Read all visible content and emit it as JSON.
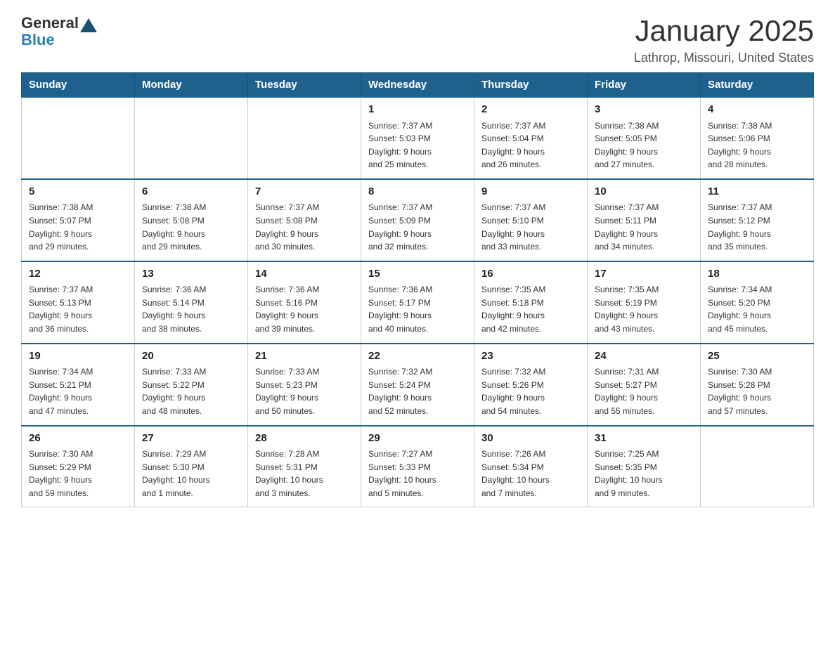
{
  "logo": {
    "general": "General",
    "blue": "Blue"
  },
  "title": "January 2025",
  "subtitle": "Lathrop, Missouri, United States",
  "days_of_week": [
    "Sunday",
    "Monday",
    "Tuesday",
    "Wednesday",
    "Thursday",
    "Friday",
    "Saturday"
  ],
  "weeks": [
    [
      {
        "day": "",
        "info": ""
      },
      {
        "day": "",
        "info": ""
      },
      {
        "day": "",
        "info": ""
      },
      {
        "day": "1",
        "info": "Sunrise: 7:37 AM\nSunset: 5:03 PM\nDaylight: 9 hours\nand 25 minutes."
      },
      {
        "day": "2",
        "info": "Sunrise: 7:37 AM\nSunset: 5:04 PM\nDaylight: 9 hours\nand 26 minutes."
      },
      {
        "day": "3",
        "info": "Sunrise: 7:38 AM\nSunset: 5:05 PM\nDaylight: 9 hours\nand 27 minutes."
      },
      {
        "day": "4",
        "info": "Sunrise: 7:38 AM\nSunset: 5:06 PM\nDaylight: 9 hours\nand 28 minutes."
      }
    ],
    [
      {
        "day": "5",
        "info": "Sunrise: 7:38 AM\nSunset: 5:07 PM\nDaylight: 9 hours\nand 29 minutes."
      },
      {
        "day": "6",
        "info": "Sunrise: 7:38 AM\nSunset: 5:08 PM\nDaylight: 9 hours\nand 29 minutes."
      },
      {
        "day": "7",
        "info": "Sunrise: 7:37 AM\nSunset: 5:08 PM\nDaylight: 9 hours\nand 30 minutes."
      },
      {
        "day": "8",
        "info": "Sunrise: 7:37 AM\nSunset: 5:09 PM\nDaylight: 9 hours\nand 32 minutes."
      },
      {
        "day": "9",
        "info": "Sunrise: 7:37 AM\nSunset: 5:10 PM\nDaylight: 9 hours\nand 33 minutes."
      },
      {
        "day": "10",
        "info": "Sunrise: 7:37 AM\nSunset: 5:11 PM\nDaylight: 9 hours\nand 34 minutes."
      },
      {
        "day": "11",
        "info": "Sunrise: 7:37 AM\nSunset: 5:12 PM\nDaylight: 9 hours\nand 35 minutes."
      }
    ],
    [
      {
        "day": "12",
        "info": "Sunrise: 7:37 AM\nSunset: 5:13 PM\nDaylight: 9 hours\nand 36 minutes."
      },
      {
        "day": "13",
        "info": "Sunrise: 7:36 AM\nSunset: 5:14 PM\nDaylight: 9 hours\nand 38 minutes."
      },
      {
        "day": "14",
        "info": "Sunrise: 7:36 AM\nSunset: 5:16 PM\nDaylight: 9 hours\nand 39 minutes."
      },
      {
        "day": "15",
        "info": "Sunrise: 7:36 AM\nSunset: 5:17 PM\nDaylight: 9 hours\nand 40 minutes."
      },
      {
        "day": "16",
        "info": "Sunrise: 7:35 AM\nSunset: 5:18 PM\nDaylight: 9 hours\nand 42 minutes."
      },
      {
        "day": "17",
        "info": "Sunrise: 7:35 AM\nSunset: 5:19 PM\nDaylight: 9 hours\nand 43 minutes."
      },
      {
        "day": "18",
        "info": "Sunrise: 7:34 AM\nSunset: 5:20 PM\nDaylight: 9 hours\nand 45 minutes."
      }
    ],
    [
      {
        "day": "19",
        "info": "Sunrise: 7:34 AM\nSunset: 5:21 PM\nDaylight: 9 hours\nand 47 minutes."
      },
      {
        "day": "20",
        "info": "Sunrise: 7:33 AM\nSunset: 5:22 PM\nDaylight: 9 hours\nand 48 minutes."
      },
      {
        "day": "21",
        "info": "Sunrise: 7:33 AM\nSunset: 5:23 PM\nDaylight: 9 hours\nand 50 minutes."
      },
      {
        "day": "22",
        "info": "Sunrise: 7:32 AM\nSunset: 5:24 PM\nDaylight: 9 hours\nand 52 minutes."
      },
      {
        "day": "23",
        "info": "Sunrise: 7:32 AM\nSunset: 5:26 PM\nDaylight: 9 hours\nand 54 minutes."
      },
      {
        "day": "24",
        "info": "Sunrise: 7:31 AM\nSunset: 5:27 PM\nDaylight: 9 hours\nand 55 minutes."
      },
      {
        "day": "25",
        "info": "Sunrise: 7:30 AM\nSunset: 5:28 PM\nDaylight: 9 hours\nand 57 minutes."
      }
    ],
    [
      {
        "day": "26",
        "info": "Sunrise: 7:30 AM\nSunset: 5:29 PM\nDaylight: 9 hours\nand 59 minutes."
      },
      {
        "day": "27",
        "info": "Sunrise: 7:29 AM\nSunset: 5:30 PM\nDaylight: 10 hours\nand 1 minute."
      },
      {
        "day": "28",
        "info": "Sunrise: 7:28 AM\nSunset: 5:31 PM\nDaylight: 10 hours\nand 3 minutes."
      },
      {
        "day": "29",
        "info": "Sunrise: 7:27 AM\nSunset: 5:33 PM\nDaylight: 10 hours\nand 5 minutes."
      },
      {
        "day": "30",
        "info": "Sunrise: 7:26 AM\nSunset: 5:34 PM\nDaylight: 10 hours\nand 7 minutes."
      },
      {
        "day": "31",
        "info": "Sunrise: 7:25 AM\nSunset: 5:35 PM\nDaylight: 10 hours\nand 9 minutes."
      },
      {
        "day": "",
        "info": ""
      }
    ]
  ]
}
